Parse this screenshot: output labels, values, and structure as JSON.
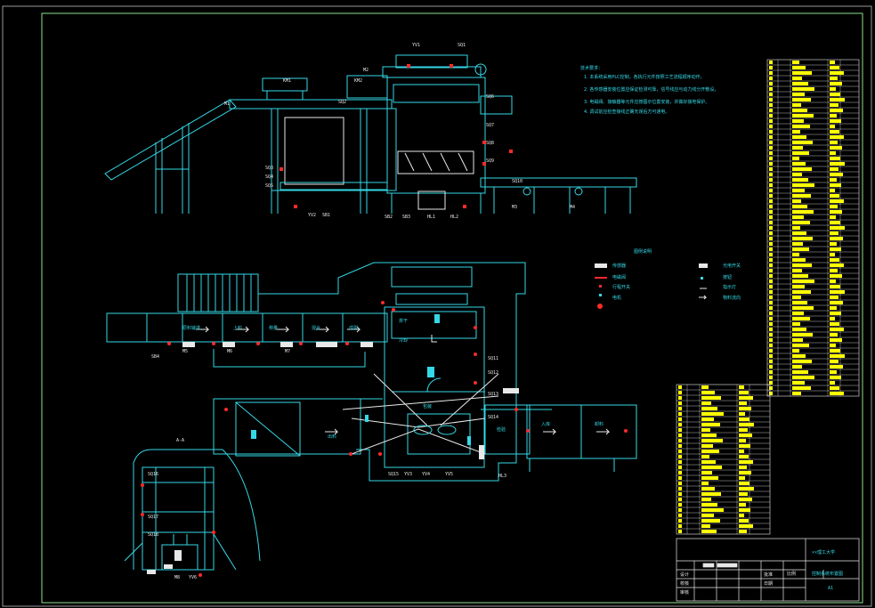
{
  "drawing": {
    "colors": {
      "background": "#000000",
      "frame": "#8ee08e",
      "primary": "#34d8e6",
      "secondary": "#e8e8e8",
      "accent_red": "#ff2a2a",
      "accent_yellow": "#ffff00"
    },
    "top_view": {
      "labels": [
        "M1",
        "YV1",
        "SQ1",
        "M2",
        "SQ2",
        "SQ3",
        "SQ4",
        "SQ5",
        "SQ6",
        "SQ7",
        "SQ8",
        "SQ9",
        "SQ10",
        "YV2",
        "SB1",
        "SB2",
        "SB3",
        "HL1",
        "HL2",
        "M3",
        "M4",
        "KM1",
        "KM2"
      ]
    },
    "notes": {
      "title": "技术要求：",
      "lines": [
        "1. 本系统采用PLC控制，各执行元件按照工艺流程顺序动作。",
        "2. 各传感器安装位置应保证检测可靠，信号线应与动力线分开敷设。",
        "3. 电磁阀、接触器等元件应按图示位置安装，并做好接地保护。",
        "4. 调试前应检查接线正确无误后方可通电。"
      ]
    },
    "legend": {
      "title": "图例说明",
      "items": [
        "传感器",
        "电磁阀",
        "行程开关",
        "电机",
        "光电开关",
        "按钮",
        "指示灯",
        "物料流向"
      ]
    },
    "plan_view": {
      "labels": [
        "原料输送",
        "上料",
        "称量",
        "混合",
        "成型",
        "烘干",
        "冷却",
        "包装",
        "检验",
        "入库",
        "卸料",
        "出料",
        "M5",
        "M6",
        "M7",
        "SQ11",
        "SQ12",
        "SQ13",
        "SQ14",
        "SQ15",
        "YV3",
        "YV4",
        "YV5",
        "HL3",
        "SB4"
      ]
    },
    "section_view": {
      "labels": [
        "A-A",
        "SQ16",
        "SQ17",
        "SQ18",
        "M8",
        "YV6"
      ]
    },
    "title_block": {
      "school": "××理工大学",
      "drawing_name": "控制系统布置图",
      "scale_label": "比例",
      "sheet": "A1",
      "rows": [
        "设计",
        "校核",
        "审核",
        "批准",
        "日期"
      ]
    }
  }
}
